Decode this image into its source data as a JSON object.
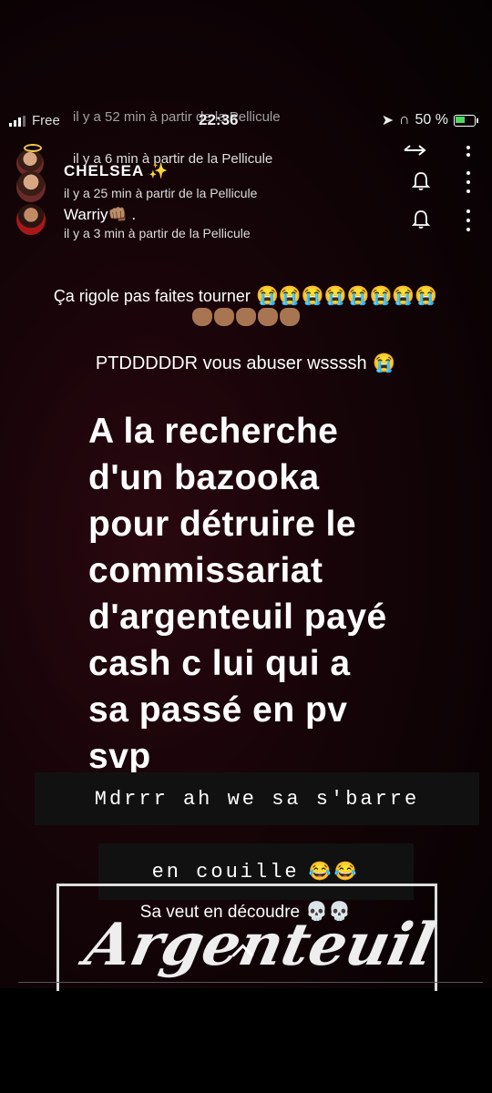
{
  "status_bar": {
    "carrier": "Free",
    "time": "22:36",
    "battery": "50 %",
    "ghost_overlay": "il y a 52 min à partir de la Pellicule"
  },
  "viewers": [
    {
      "name": "",
      "time": "il y a 6 min à partir de la Pellicule"
    },
    {
      "name": "CHELSEA ✨",
      "time": "il y a 25 min à partir de la Pellicule"
    },
    {
      "name": "Warriy👊🏽 .",
      "time": "il y a 3 min à partir de la Pellicule"
    }
  ],
  "story": {
    "caption_top": "Ça rigole pas faites tourner",
    "caption_top_emoji": "😭😭😭😭😭😭😭😭",
    "caption_second": "PTDDDDDR vous abuser wssssh",
    "caption_second_emoji": "😭",
    "main_text": [
      "A la recherche",
      "d'un bazooka",
      "pour détruire le",
      "commissariat",
      "d'argenteuil payé",
      "cash c lui qui a",
      "sa passé en pv",
      "svp"
    ],
    "type_line_1": "Mdrrr ah we sa s'barre",
    "type_line_2": "en couille",
    "type_line_2_emoji": "😂😂",
    "caption_bottom": "Sa veut en découdre",
    "caption_bottom_emoji": "💀💀",
    "script_logo": "Argenteuil"
  },
  "colors": {
    "background": "#000000",
    "story_bg": "#1a050a",
    "battery_fill": "#4cd964"
  }
}
